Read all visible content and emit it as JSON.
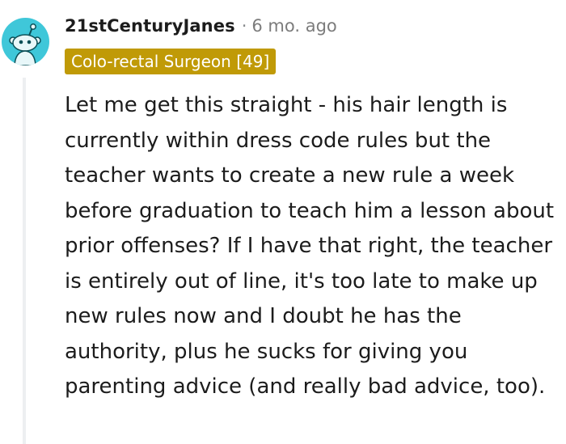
{
  "comment": {
    "username": "21stCenturyJanes",
    "separator": "·",
    "timestamp": "6 mo. ago",
    "flair": "Colo-rectal Surgeon [49]",
    "body": "Let me get this straight - his hair length is currently within dress code rules but the teacher wants to create a new rule a week before graduation to teach him a lesson about prior offenses? If I have that right, the teacher is entirely out of line, it's too late to make up new rules now and I doubt he has the authority, plus he sucks for giving you parenting advice (and really bad advice, too).",
    "avatar_icon": "snoo-avatar-icon"
  },
  "colors": {
    "avatar_bg": "#3fc7d9",
    "flair_bg": "#c09a07",
    "flair_text": "#ffffff",
    "text": "#1c1c1c",
    "meta_text": "#7c7c7c",
    "thread_line": "#edeff1"
  }
}
